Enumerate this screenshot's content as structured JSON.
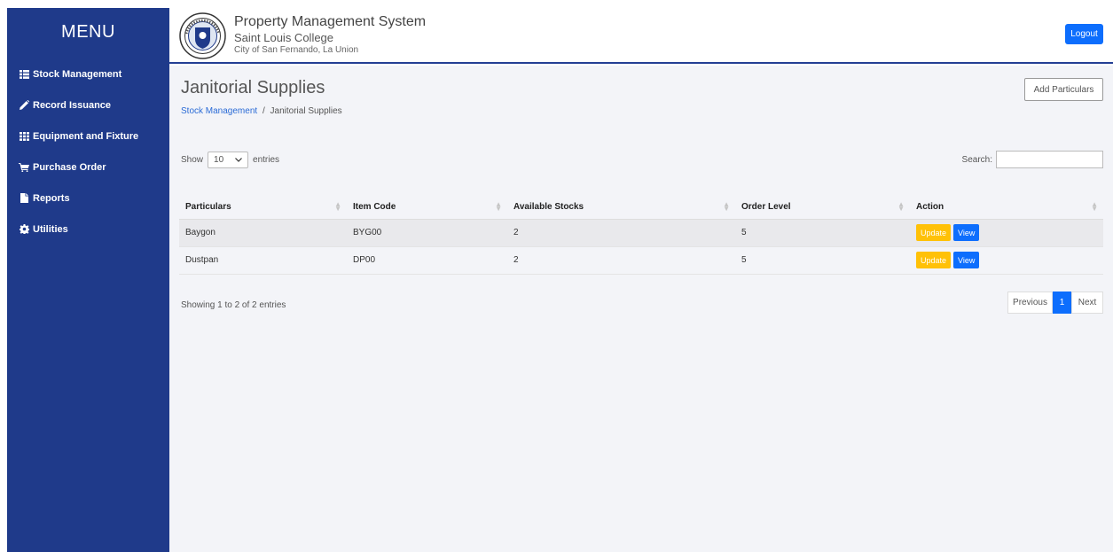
{
  "sidebar": {
    "title": "MENU",
    "items": [
      {
        "label": "Stock Management",
        "icon": "list-icon"
      },
      {
        "label": "Record Issuance",
        "icon": "pencil-icon"
      },
      {
        "label": "Equipment and Fixture",
        "icon": "grid-icon"
      },
      {
        "label": "Purchase Order",
        "icon": "cart-icon"
      },
      {
        "label": "Reports",
        "icon": "file-icon"
      },
      {
        "label": "Utilities",
        "icon": "gear-icon"
      }
    ]
  },
  "header": {
    "system_title": "Property Management System",
    "school": "Saint Louis College",
    "city": "City of San Fernando, La Union",
    "logout_label": "Logout"
  },
  "page": {
    "title": "Janitorial Supplies",
    "add_label": "Add Particulars",
    "breadcrumb": {
      "parent": "Stock Management",
      "separator": "/",
      "current": "Janitorial Supplies"
    }
  },
  "table_controls": {
    "show_label": "Show",
    "entries_value": "10",
    "entries_label": "entries",
    "search_label": "Search:",
    "search_placeholder": ""
  },
  "table": {
    "columns": [
      "Particulars",
      "Item Code",
      "Available Stocks",
      "Order Level",
      "Action"
    ],
    "rows": [
      {
        "particulars": "Baygon",
        "item_code": "BYG00",
        "available": "2",
        "order_level": "5"
      },
      {
        "particulars": "Dustpan",
        "item_code": "DP00",
        "available": "2",
        "order_level": "5"
      }
    ],
    "update_label": "Update",
    "view_label": "View"
  },
  "footer": {
    "showing_text": "Showing 1 to 2 of 2 entries",
    "previous_label": "Previous",
    "current_page": "1",
    "next_label": "Next"
  },
  "colors": {
    "sidebar": "#1f3a8a",
    "primary": "#0d6efd",
    "warning": "#ffc107",
    "content_bg": "#f3f4f8"
  }
}
